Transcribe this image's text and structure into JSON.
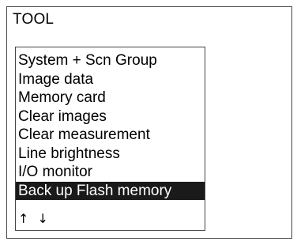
{
  "screen": {
    "title": "TOOL"
  },
  "menu": {
    "items": [
      {
        "label": "System + Scn Group",
        "selected": false
      },
      {
        "label": "Image data",
        "selected": false
      },
      {
        "label": "Memory card",
        "selected": false
      },
      {
        "label": "Clear images",
        "selected": false
      },
      {
        "label": "Clear measurement",
        "selected": false
      },
      {
        "label": "Line brightness",
        "selected": false
      },
      {
        "label": "I/O monitor",
        "selected": false
      },
      {
        "label": "Back up Flash memory",
        "selected": true
      }
    ],
    "scroll_up_glyph": "↑",
    "scroll_down_glyph": "↓"
  }
}
